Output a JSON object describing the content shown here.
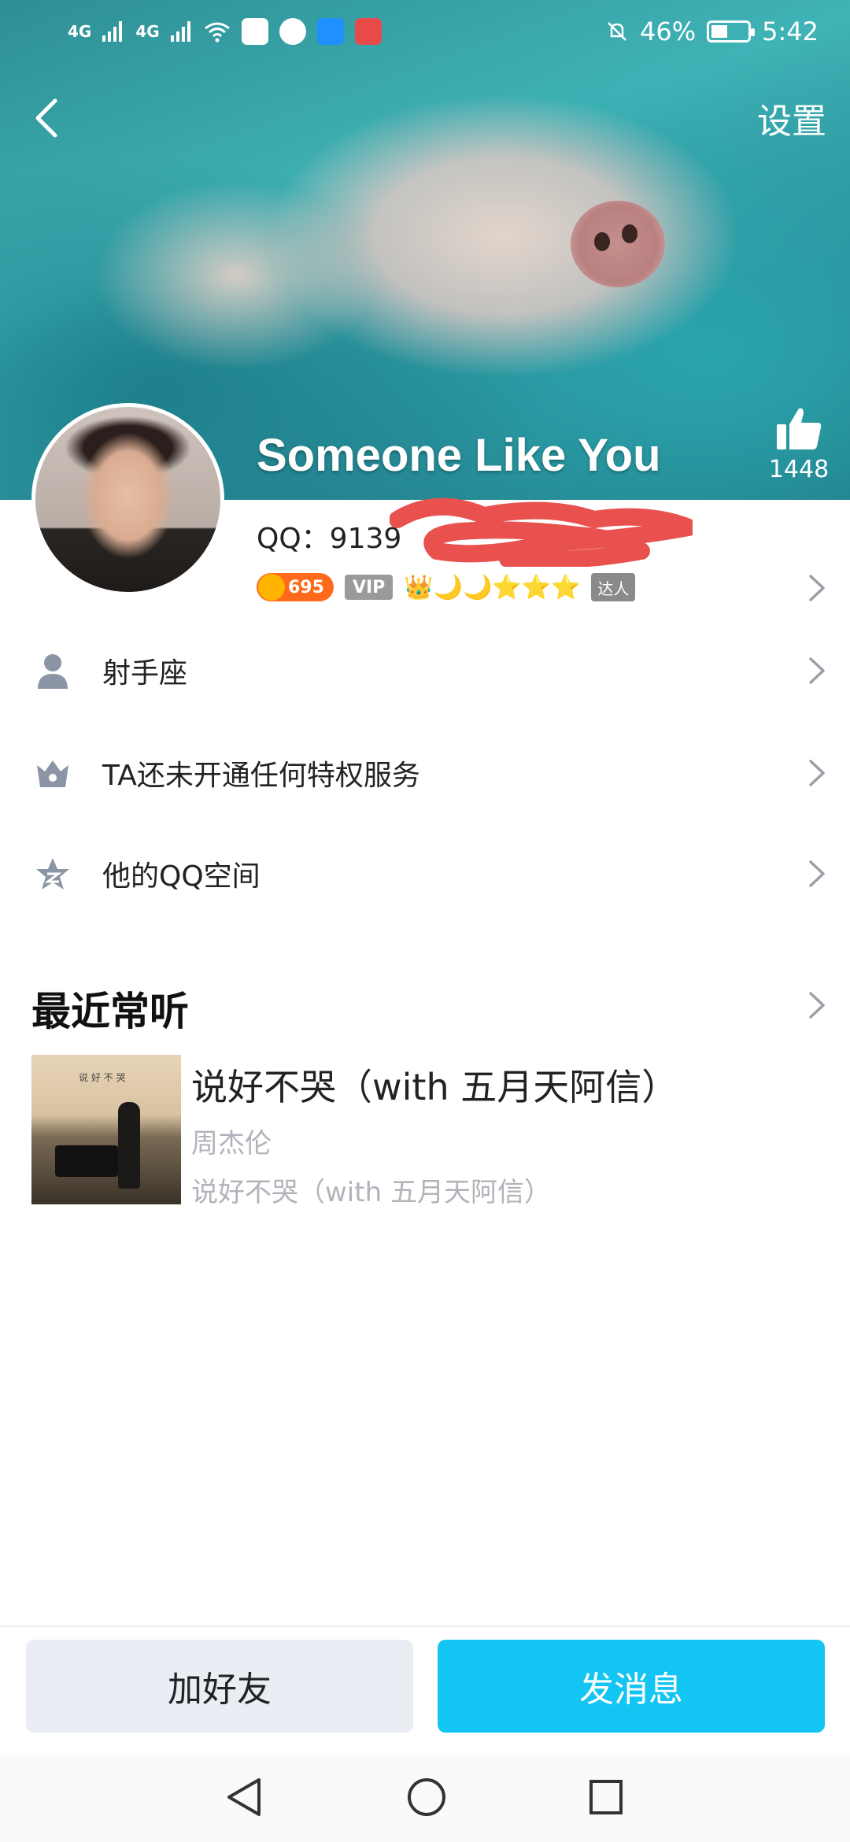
{
  "status_bar": {
    "network_1": "4G",
    "network_2": "4G",
    "battery": "46%",
    "battery_level": 0.46,
    "time": "5:42",
    "app_icon_colors": [
      "#ffffff",
      "#ffffff",
      "#1e90ff",
      "#e84a4a"
    ]
  },
  "header": {
    "settings_label": "设置",
    "name": "Someone Like You",
    "like_count": "1448"
  },
  "profile": {
    "qq_label": "QQ：9139",
    "level_badge": "695",
    "vip_badge": "VIP",
    "level_icons": "👑🌙🌙⭐⭐⭐",
    "daren_badge": "达人"
  },
  "list": [
    {
      "label": "射手座",
      "icon": "person-icon"
    },
    {
      "label": "TA还未开通任何特权服务",
      "icon": "crown-icon"
    },
    {
      "label": "他的QQ空间",
      "icon": "qzone-star-icon"
    }
  ],
  "recent": {
    "title": "最近常听",
    "song_title": "说好不哭（with 五月天阿信）",
    "artist": "周杰伦",
    "album": "说好不哭（with 五月天阿信）",
    "album_art_text": "说 好 不 哭"
  },
  "actions": {
    "add_friend": "加好友",
    "send_message": "发消息"
  },
  "colors": {
    "accent": "#12c5f3",
    "secondary_button": "#ebedf5",
    "muted_text": "#b0b4ba",
    "chevron": "#9aa0a8"
  }
}
